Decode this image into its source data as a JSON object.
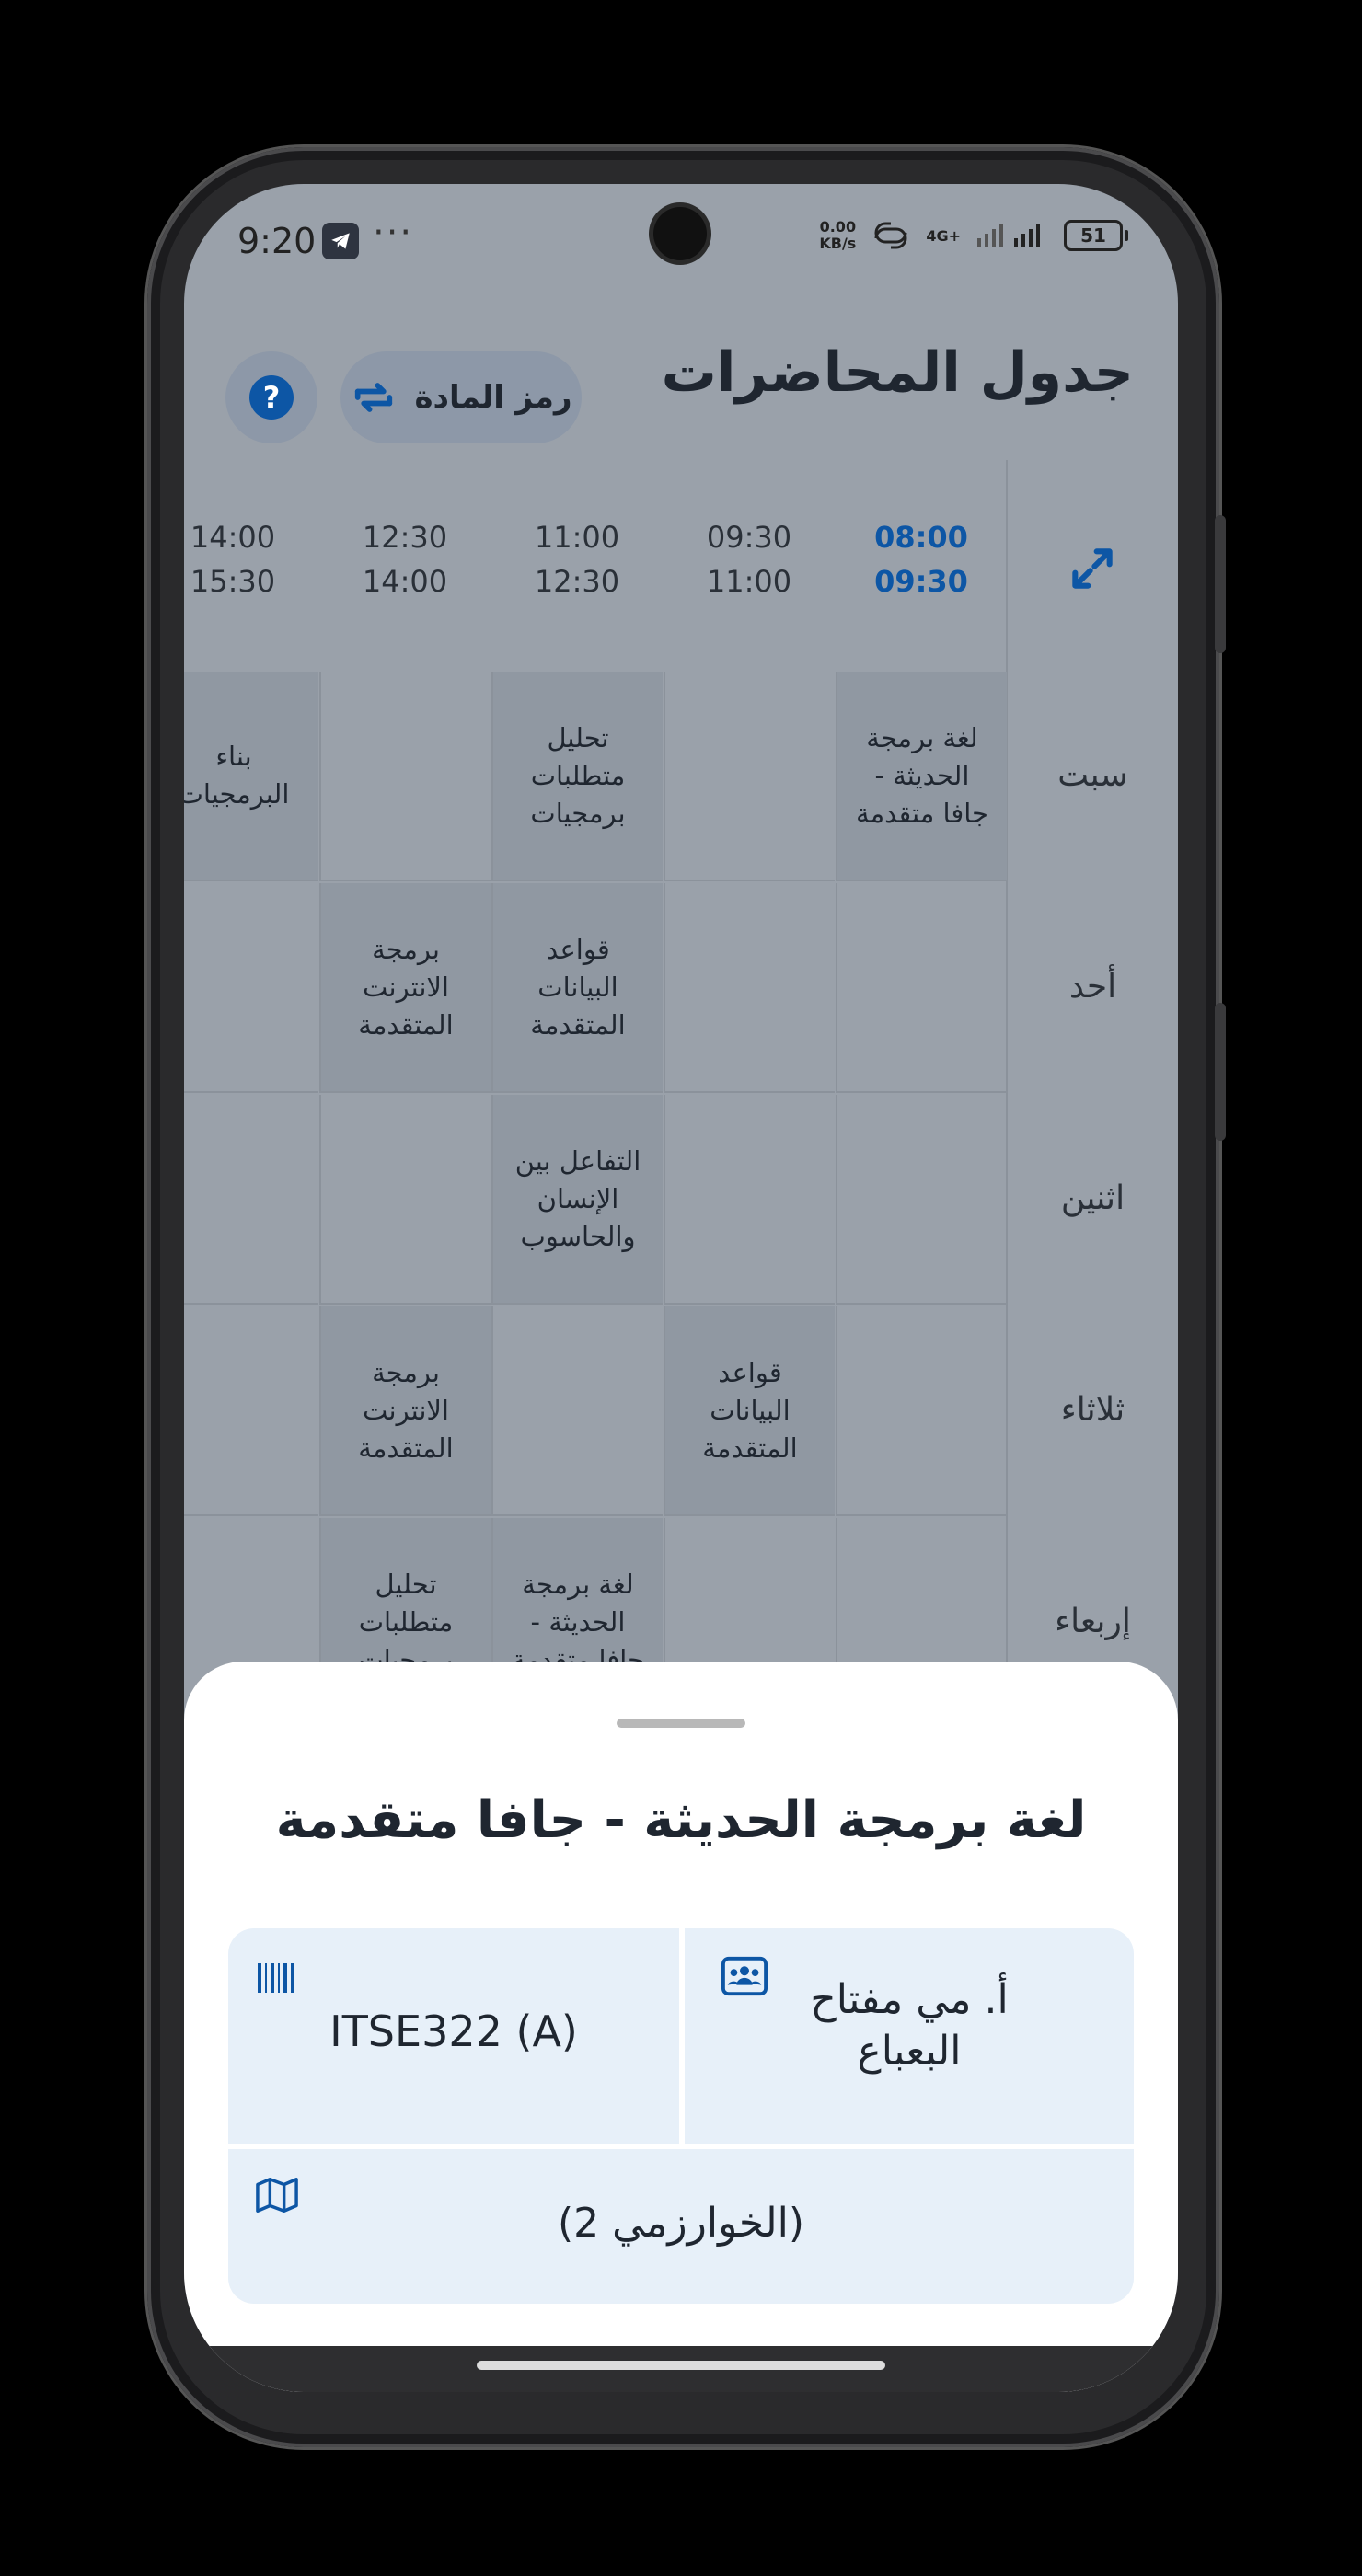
{
  "status_bar": {
    "time": "9:20",
    "more": "···",
    "net_speed_top": "0.00",
    "net_speed_bottom": "KB/s",
    "network": "4G+",
    "battery": "51"
  },
  "header": {
    "title": "جدول المحاضرات",
    "course_code_button": "رمز المادة",
    "help_icon": "?"
  },
  "timetable": {
    "times": [
      {
        "start": "08:00",
        "end": "09:30",
        "active": true
      },
      {
        "start": "09:30",
        "end": "11:00",
        "active": false
      },
      {
        "start": "11:00",
        "end": "12:30",
        "active": false
      },
      {
        "start": "12:30",
        "end": "14:00",
        "active": false
      },
      {
        "start": "14:00",
        "end": "15:30",
        "active": false
      }
    ],
    "days": [
      "سبت",
      "أحد",
      "اثنين",
      "ثلاثاء",
      "إربعاء"
    ],
    "rows": [
      [
        "لغة برمجة الحديثة - جافا متقدمة",
        "",
        "تحليل متطلبات برمجيات",
        "",
        "بناء البرمجيات"
      ],
      [
        "",
        "",
        "قواعد البيانات المتقدمة",
        "برمجة الانترنت المتقدمة",
        ""
      ],
      [
        "",
        "",
        "التفاعل بين الإنسان والحاسوب",
        "",
        ""
      ],
      [
        "",
        "قواعد البيانات المتقدمة",
        "",
        "برمجة الانترنت المتقدمة",
        ""
      ],
      [
        "",
        "",
        "لغة برمجة الحديثة - جافا متقدمة",
        "تحليل متطلبات برمجيات",
        ""
      ]
    ]
  },
  "detail_sheet": {
    "title": "لغة برمجة الحديثة - جافا متقدمة",
    "instructor_line1": "أ. مي مفتاح",
    "instructor_line2": "البعباع",
    "course_code": "ITSE322 (A)",
    "location": "(الخوارزمي 2)",
    "icons": [
      "instructor-icon",
      "barcode-icon",
      "map-icon"
    ],
    "accent": "#0d56a5"
  }
}
